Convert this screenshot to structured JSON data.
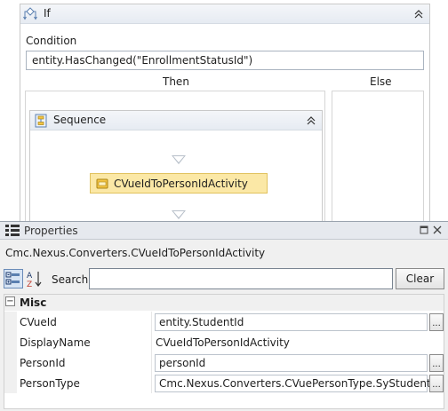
{
  "designer": {
    "if_activity": {
      "title": "If",
      "condition_label": "Condition",
      "condition_value": "entity.HasChanged(\"EnrollmentStatusId\")",
      "then_label": "Then",
      "else_label": "Else",
      "sequence": {
        "title": "Sequence",
        "activity_label": "CVueIdToPersonIdActivity"
      }
    }
  },
  "properties": {
    "title": "Properties",
    "object_name": "Cmc.Nexus.Converters.CVueIdToPersonIdActivity",
    "search_label": "Search:",
    "search_value": "",
    "clear_label": "Clear",
    "category": "Misc",
    "rows": [
      {
        "name": "CVueId",
        "value": "entity.StudentId",
        "editable": true
      },
      {
        "name": "DisplayName",
        "value": "CVueIdToPersonIdActivity",
        "editable": false
      },
      {
        "name": "PersonId",
        "value": "personId",
        "editable": true
      },
      {
        "name": "PersonType",
        "value": "Cmc.Nexus.Converters.CVuePersonType.SyStudent",
        "editable": true
      }
    ],
    "ellipsis_label": "..."
  }
}
